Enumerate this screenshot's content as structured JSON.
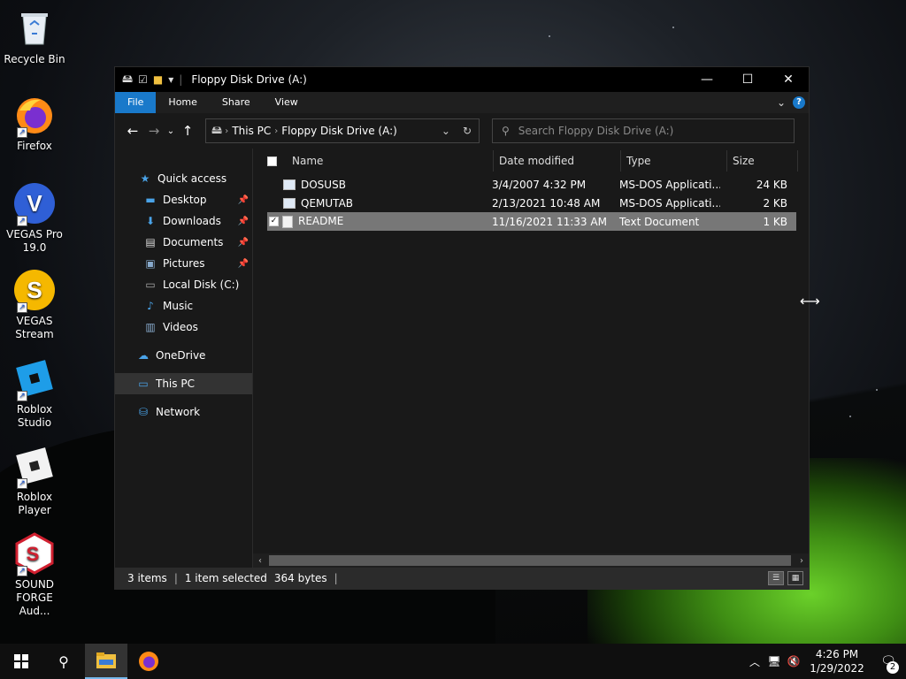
{
  "desktop": {
    "icons": [
      {
        "label": "Recycle Bin"
      },
      {
        "label": "Firefox"
      },
      {
        "label": "VEGAS Pro 19.0"
      },
      {
        "label": "VEGAS Stream"
      },
      {
        "label": "Roblox Studio"
      },
      {
        "label": "Roblox Player"
      },
      {
        "label": "SOUND FORGE Aud..."
      }
    ]
  },
  "window": {
    "title": "Floppy Disk Drive (A:)",
    "ribbon_tabs": [
      "File",
      "Home",
      "Share",
      "View"
    ],
    "address": {
      "root": "This PC",
      "current": "Floppy Disk Drive (A:)"
    },
    "search_placeholder": "Search Floppy Disk Drive (A:)",
    "nav": [
      {
        "label": "Quick access",
        "icon": "star-icon"
      },
      {
        "label": "Desktop",
        "icon": "desktop-icon",
        "pinned": true
      },
      {
        "label": "Downloads",
        "icon": "download-icon",
        "pinned": true
      },
      {
        "label": "Documents",
        "icon": "document-icon",
        "pinned": true
      },
      {
        "label": "Pictures",
        "icon": "picture-icon",
        "pinned": true
      },
      {
        "label": "Local Disk (C:)",
        "icon": "drive-icon"
      },
      {
        "label": "Music",
        "icon": "music-icon"
      },
      {
        "label": "Videos",
        "icon": "video-icon"
      },
      {
        "label": "OneDrive",
        "icon": "cloud-icon"
      },
      {
        "label": "This PC",
        "icon": "computer-icon"
      },
      {
        "label": "Network",
        "icon": "network-icon"
      }
    ],
    "columns": [
      "Name",
      "Date modified",
      "Type",
      "Size"
    ],
    "files": [
      {
        "name": "DOSUSB",
        "date": "3/4/2007 4:32 PM",
        "type": "MS-DOS Applicati...",
        "size": "24 KB"
      },
      {
        "name": "QEMUTAB",
        "date": "2/13/2021 10:48 AM",
        "type": "MS-DOS Applicati...",
        "size": "2 KB"
      },
      {
        "name": "README",
        "date": "11/16/2021 11:33 AM",
        "type": "Text Document",
        "size": "1 KB"
      }
    ],
    "status": {
      "items": "3 items",
      "selected": "1 item selected",
      "bytes": "364 bytes"
    }
  },
  "taskbar": {
    "time": "4:26 PM",
    "date": "1/29/2022",
    "notification_count": "2"
  },
  "colors": {
    "accent": "#1979ca",
    "window_bg": "#191919",
    "selected_row": "#777777"
  }
}
